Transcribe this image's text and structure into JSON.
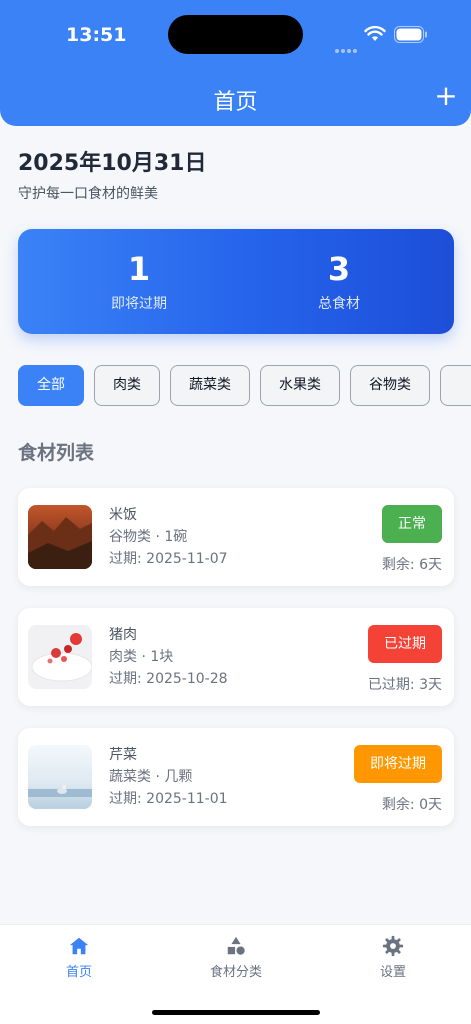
{
  "status": {
    "time": "13:51"
  },
  "header": {
    "title": "首页",
    "add_label": "+"
  },
  "date": "2025年10月31日",
  "subtitle": "守护每一口食材的鲜美",
  "stats": [
    {
      "value": "1",
      "label": "即将过期"
    },
    {
      "value": "3",
      "label": "总食材"
    }
  ],
  "filters": [
    "全部",
    "肉类",
    "蔬菜类",
    "水果类",
    "谷物类"
  ],
  "section_title": "食材列表",
  "items": [
    {
      "name": "米饭",
      "meta": "谷物类 · 1碗",
      "expiry": "过期: 2025-11-07",
      "status": "正常",
      "status_color": "#4caf50",
      "remain": "剩余: 6天"
    },
    {
      "name": "猪肉",
      "meta": "肉类 · 1块",
      "expiry": "过期: 2025-10-28",
      "status": "已过期",
      "status_color": "#f44336",
      "remain": "已过期: 3天"
    },
    {
      "name": "芹菜",
      "meta": "蔬菜类 · 几颗",
      "expiry": "过期: 2025-11-01",
      "status": "即将过期",
      "status_color": "#ff9800",
      "remain": "剩余: 0天"
    }
  ],
  "tabs": [
    {
      "label": "首页",
      "icon": "home-icon"
    },
    {
      "label": "食材分类",
      "icon": "category-shapes-icon"
    },
    {
      "label": "设置",
      "icon": "gear-icon"
    }
  ],
  "colors": {
    "primary": "#3b82f6",
    "normal": "#4caf50",
    "expired": "#f44336",
    "expiring": "#ff9800"
  }
}
